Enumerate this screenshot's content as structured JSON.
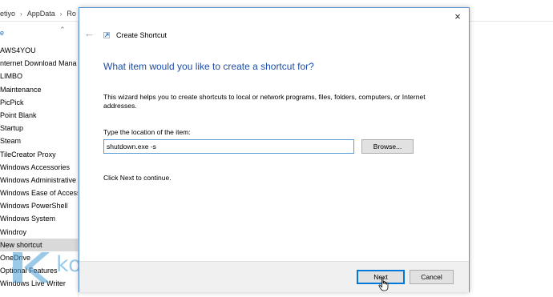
{
  "explorer": {
    "breadcrumb": [
      "etiyo",
      "AppData",
      "Ro"
    ],
    "nav_header": "e",
    "nav_items": [
      "AWS4YOU",
      "nternet Download Mana",
      "LIMBO",
      "Maintenance",
      "PicPick",
      "Point Blank",
      "Startup",
      "Steam",
      "TileCreator Proxy",
      "Windows Accessories",
      "Windows Administrative",
      "Windows Ease of Access",
      "Windows PowerShell",
      "Windows System",
      "Windroy",
      "New shortcut",
      "OneDrive",
      "Optional Features",
      "Windows Live Writer"
    ],
    "selected_item": "New shortcut"
  },
  "watermark": {
    "text": "kompiwin"
  },
  "dialog": {
    "title": "Create Shortcut",
    "heading": "What item would you like to create a shortcut for?",
    "description": "This wizard helps you to create shortcuts to local or network programs, files, folders, computers, or Internet addresses.",
    "location_label": "Type the location of the item:",
    "location_value": "shutdown.exe -s",
    "browse_label": "Browse...",
    "hint": "Click Next to continue.",
    "next_label": "Next",
    "cancel_label": "Cancel",
    "close_glyph": "×",
    "back_glyph": "←"
  },
  "colors": {
    "heading": "#1f4ea8",
    "accent": "#0078d7",
    "nav_link": "#1b6ac9",
    "selected_bg": "#d9d9d9",
    "watermark": "#4a9fd8"
  }
}
